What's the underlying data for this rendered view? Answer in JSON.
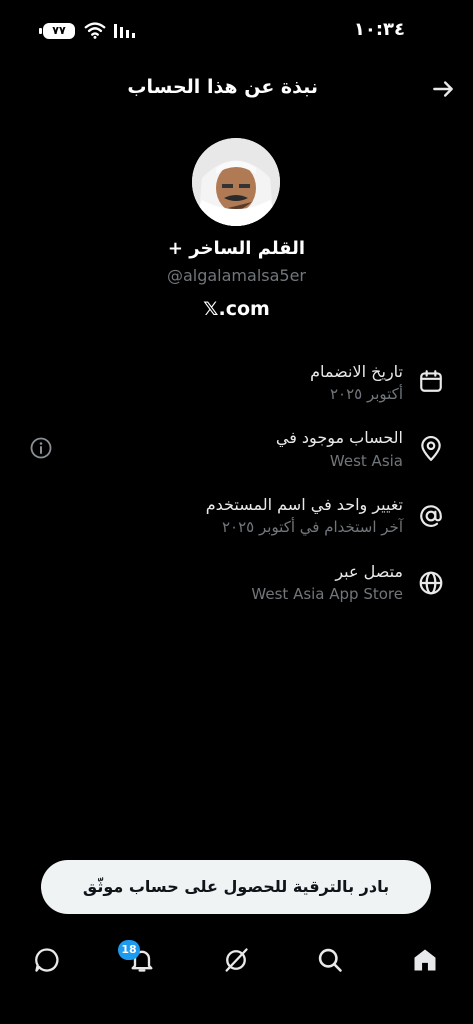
{
  "status_bar": {
    "time": "١٠:٣٤",
    "battery": "٧٧"
  },
  "header": {
    "title": "نبذة عن هذا الحساب"
  },
  "profile": {
    "name": "القلم الساخر +",
    "handle": "@algalamalsa5er",
    "website": "𝕏.com"
  },
  "info_rows": [
    {
      "icon": "calendar-icon",
      "title": "تاريخ الانضمام",
      "value": "أكتوبر ٢٠٢٥"
    },
    {
      "icon": "location-pin-icon",
      "title": "الحساب موجود في",
      "value": "West Asia"
    },
    {
      "icon": "at-sign-icon",
      "title": "تغيير واحد في اسم المستخدم",
      "value": "آخر استخدام في أكتوبر ٢٠٢٥"
    },
    {
      "icon": "globe-icon",
      "title": "متصل عبر",
      "value": "West Asia App Store"
    }
  ],
  "upgrade_banner": {
    "label": "بادر بالترقية للحصول على حساب موثّق"
  },
  "tab_bar": {
    "notifications_count": "18",
    "tabs": [
      "home-icon",
      "search-icon",
      "grok-icon",
      "notifications-icon",
      "messages-icon"
    ]
  },
  "colors": {
    "background": "#000000",
    "text_primary": "#e7e9ea",
    "text_secondary": "#71767b",
    "accent": "#1d9bf0",
    "banner_bg": "#eff3f4"
  }
}
